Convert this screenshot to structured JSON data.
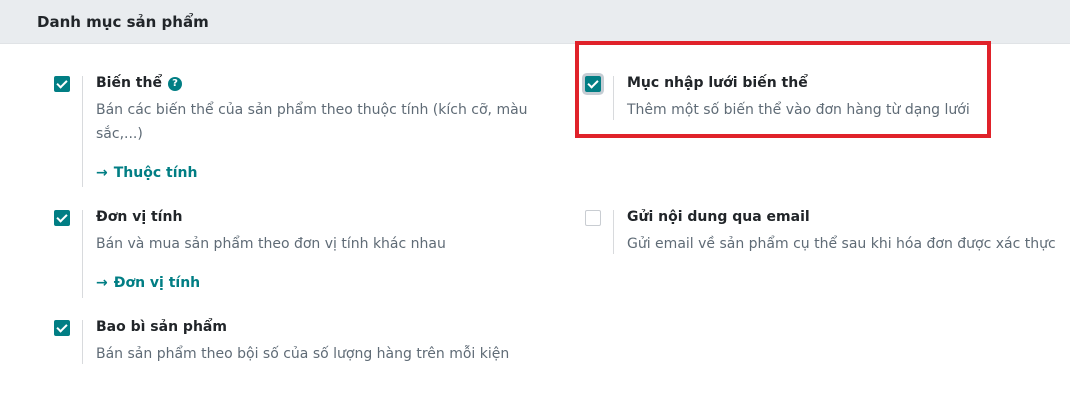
{
  "section": {
    "title": "Danh mục sản phẩm"
  },
  "settings": {
    "variants": {
      "title": "Biến thể",
      "help": "?",
      "description": "Bán các biến thể của sản phẩm theo thuộc tính (kích cỡ, màu sắc,...)",
      "link_label": "Thuộc tính",
      "checked": true
    },
    "variant_grid": {
      "title": "Mục nhập lưới biến thể",
      "description": "Thêm một số biến thể vào đơn hàng từ dạng lưới",
      "checked": true
    },
    "uom": {
      "title": "Đơn vị tính",
      "description": "Bán và mua sản phẩm theo đơn vị tính khác nhau",
      "link_label": "Đơn vị tính",
      "checked": true
    },
    "email": {
      "title": "Gửi nội dung qua email",
      "description": "Gửi email về sản phẩm cụ thể sau khi hóa đơn được xác thực",
      "checked": false
    },
    "packaging": {
      "title": "Bao bì sản phẩm",
      "description": "Bán sản phẩm theo bội số của số lượng hàng trên mỗi kiện",
      "checked": true
    }
  },
  "icons": {
    "arrow": "→",
    "help": "question-circle-icon"
  },
  "colors": {
    "accent": "#017e84",
    "highlight": "#e0222a",
    "header_bg": "#e9ecef"
  }
}
